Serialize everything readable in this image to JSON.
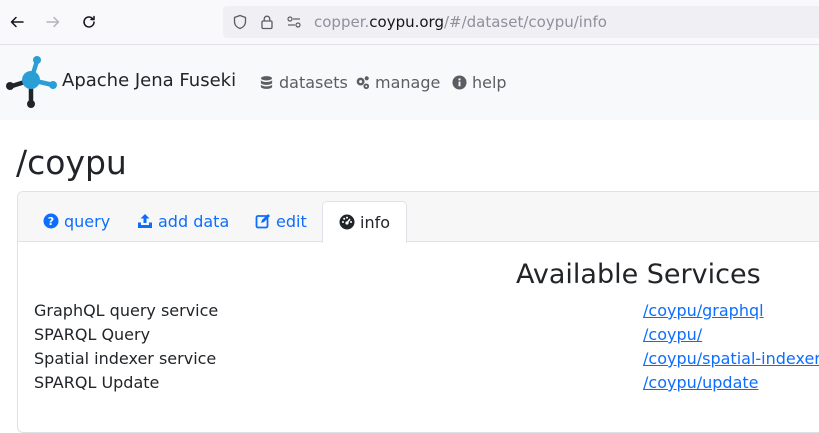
{
  "browser": {
    "url_prefix": "copper.",
    "url_domain": "coypu.org",
    "url_path": "/#/dataset/coypu/info"
  },
  "header": {
    "brand": "Apache Jena Fuseki",
    "menu": [
      {
        "label": "datasets",
        "icon": "database-icon"
      },
      {
        "label": "manage",
        "icon": "cogs-icon"
      },
      {
        "label": "help",
        "icon": "info-circle-icon"
      }
    ]
  },
  "page": {
    "title": "/coypu"
  },
  "tabs": [
    {
      "label": "query",
      "icon": "question-circle-icon",
      "active": false
    },
    {
      "label": "add data",
      "icon": "upload-icon",
      "active": false
    },
    {
      "label": "edit",
      "icon": "edit-icon",
      "active": false
    },
    {
      "label": "info",
      "icon": "dashboard-icon",
      "active": true
    }
  ],
  "services": {
    "heading": "Available Services",
    "rows": [
      {
        "name": "GraphQL query service",
        "link": "/coypu/graphql"
      },
      {
        "name": "SPARQL Query",
        "link": "/coypu/"
      },
      {
        "name": "Spatial indexer service",
        "link": "/coypu/spatial-indexer"
      },
      {
        "name": "SPARQL Update",
        "link": "/coypu/update"
      }
    ]
  },
  "colors": {
    "link": "#0d6efd",
    "text": "#212529",
    "logo_blue": "#2a9fd6"
  }
}
